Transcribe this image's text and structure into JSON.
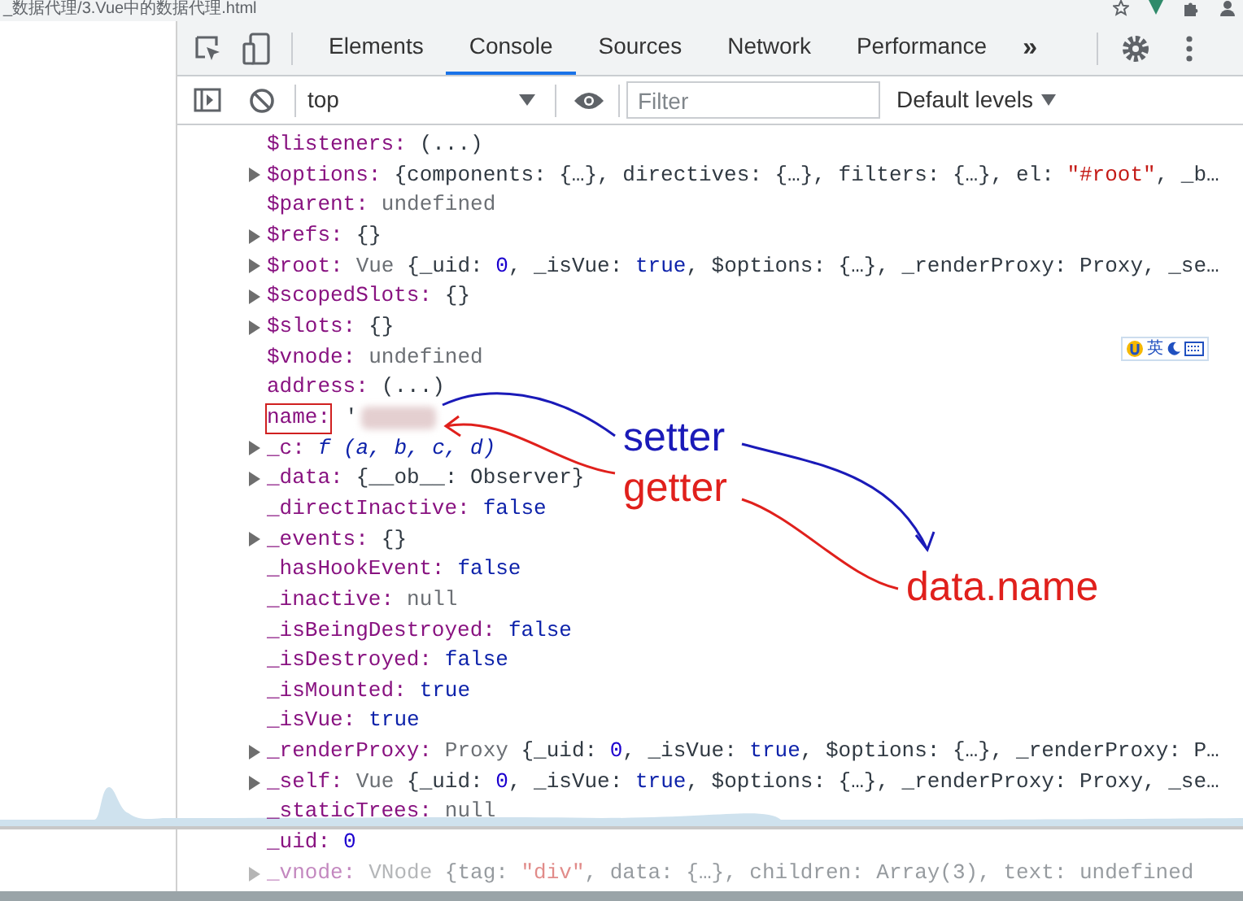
{
  "window": {
    "title": "_数据代理/3.Vue中的数据代理.html"
  },
  "tabs": [
    {
      "label": "Elements",
      "selected": false
    },
    {
      "label": "Console",
      "selected": true
    },
    {
      "label": "Sources",
      "selected": false
    },
    {
      "label": "Network",
      "selected": false
    },
    {
      "label": "Performance",
      "selected": false
    }
  ],
  "more_tabs": "»",
  "toolbar": {
    "context": "top",
    "filter_placeholder": "Filter",
    "levels": "Default levels"
  },
  "ime_bar": {
    "label": "英"
  },
  "lines": [
    {
      "key": "$listeners:",
      "expandable": false,
      "highlighted": false,
      "redacted": false,
      "dimmed": false,
      "parts": [
        {
          "text": "(...)",
          "kind": "plain"
        }
      ]
    },
    {
      "key": "$options:",
      "expandable": true,
      "highlighted": false,
      "redacted": false,
      "dimmed": false,
      "parts": [
        {
          "text": "{components: {…}, directives: {…}, filters: {…}, el: ",
          "kind": "plain"
        },
        {
          "text": "\"#root\"",
          "kind": "str"
        },
        {
          "text": ", _b…",
          "kind": "plain"
        }
      ]
    },
    {
      "key": "$parent:",
      "expandable": false,
      "highlighted": false,
      "redacted": false,
      "dimmed": false,
      "parts": [
        {
          "text": "undefined",
          "kind": "gray"
        }
      ]
    },
    {
      "key": "$refs:",
      "expandable": true,
      "highlighted": false,
      "redacted": false,
      "dimmed": false,
      "parts": [
        {
          "text": "{}",
          "kind": "plain"
        }
      ]
    },
    {
      "key": "$root:",
      "expandable": true,
      "highlighted": false,
      "redacted": false,
      "dimmed": false,
      "parts": [
        {
          "text": "Vue ",
          "kind": "gray"
        },
        {
          "text": "{_uid: ",
          "kind": "plain"
        },
        {
          "text": "0",
          "kind": "num"
        },
        {
          "text": ", _isVue: ",
          "kind": "plain"
        },
        {
          "text": "true",
          "kind": "bool"
        },
        {
          "text": ", $options: {…}, _renderProxy: Proxy, _se…",
          "kind": "plain"
        }
      ]
    },
    {
      "key": "$scopedSlots:",
      "expandable": true,
      "highlighted": false,
      "redacted": false,
      "dimmed": false,
      "parts": [
        {
          "text": "{}",
          "kind": "plain"
        }
      ]
    },
    {
      "key": "$slots:",
      "expandable": true,
      "highlighted": false,
      "redacted": false,
      "dimmed": false,
      "parts": [
        {
          "text": "{}",
          "kind": "plain"
        }
      ]
    },
    {
      "key": "$vnode:",
      "expandable": false,
      "highlighted": false,
      "redacted": false,
      "dimmed": false,
      "parts": [
        {
          "text": "undefined",
          "kind": "gray"
        }
      ]
    },
    {
      "key": "address:",
      "expandable": false,
      "highlighted": false,
      "redacted": false,
      "dimmed": false,
      "parts": [
        {
          "text": "(...)",
          "kind": "plain"
        }
      ]
    },
    {
      "key": "name:",
      "expandable": false,
      "highlighted": true,
      "redacted": true,
      "dimmed": false,
      "parts": [
        {
          "text": "'",
          "kind": "plain"
        }
      ]
    },
    {
      "key": "_c:",
      "expandable": true,
      "highlighted": false,
      "redacted": false,
      "dimmed": false,
      "parts": [
        {
          "text": "f (a, b, c, d)",
          "kind": "fn"
        }
      ]
    },
    {
      "key": "_data:",
      "expandable": true,
      "highlighted": false,
      "redacted": false,
      "dimmed": false,
      "parts": [
        {
          "text": "{__ob__: Observer}",
          "kind": "plain"
        }
      ]
    },
    {
      "key": "_directInactive:",
      "expandable": false,
      "highlighted": false,
      "redacted": false,
      "dimmed": false,
      "parts": [
        {
          "text": "false",
          "kind": "bool"
        }
      ]
    },
    {
      "key": "_events:",
      "expandable": true,
      "highlighted": false,
      "redacted": false,
      "dimmed": false,
      "parts": [
        {
          "text": "{}",
          "kind": "plain"
        }
      ]
    },
    {
      "key": "_hasHookEvent:",
      "expandable": false,
      "highlighted": false,
      "redacted": false,
      "dimmed": false,
      "parts": [
        {
          "text": "false",
          "kind": "bool"
        }
      ]
    },
    {
      "key": "_inactive:",
      "expandable": false,
      "highlighted": false,
      "redacted": false,
      "dimmed": false,
      "parts": [
        {
          "text": "null",
          "kind": "gray"
        }
      ]
    },
    {
      "key": "_isBeingDestroyed:",
      "expandable": false,
      "highlighted": false,
      "redacted": false,
      "dimmed": false,
      "parts": [
        {
          "text": "false",
          "kind": "bool"
        }
      ]
    },
    {
      "key": "_isDestroyed:",
      "expandable": false,
      "highlighted": false,
      "redacted": false,
      "dimmed": false,
      "parts": [
        {
          "text": "false",
          "kind": "bool"
        }
      ]
    },
    {
      "key": "_isMounted:",
      "expandable": false,
      "highlighted": false,
      "redacted": false,
      "dimmed": false,
      "parts": [
        {
          "text": "true",
          "kind": "bool"
        }
      ]
    },
    {
      "key": "_isVue:",
      "expandable": false,
      "highlighted": false,
      "redacted": false,
      "dimmed": false,
      "parts": [
        {
          "text": "true",
          "kind": "bool"
        }
      ]
    },
    {
      "key": "_renderProxy:",
      "expandable": true,
      "highlighted": false,
      "redacted": false,
      "dimmed": false,
      "parts": [
        {
          "text": "Proxy ",
          "kind": "gray"
        },
        {
          "text": "{_uid: ",
          "kind": "plain"
        },
        {
          "text": "0",
          "kind": "num"
        },
        {
          "text": ", _isVue: ",
          "kind": "plain"
        },
        {
          "text": "true",
          "kind": "bool"
        },
        {
          "text": ", $options: {…}, _renderProxy: P…",
          "kind": "plain"
        }
      ]
    },
    {
      "key": "_self:",
      "expandable": true,
      "highlighted": false,
      "redacted": false,
      "dimmed": false,
      "parts": [
        {
          "text": "Vue ",
          "kind": "gray"
        },
        {
          "text": "{_uid: ",
          "kind": "plain"
        },
        {
          "text": "0",
          "kind": "num"
        },
        {
          "text": ", _isVue: ",
          "kind": "plain"
        },
        {
          "text": "true",
          "kind": "bool"
        },
        {
          "text": ", $options: {…}, _renderProxy: Proxy, _se…",
          "kind": "plain"
        }
      ]
    },
    {
      "key": "_staticTrees:",
      "expandable": false,
      "highlighted": false,
      "redacted": false,
      "dimmed": false,
      "parts": [
        {
          "text": "null",
          "kind": "gray"
        }
      ]
    },
    {
      "key": "_uid:",
      "expandable": false,
      "highlighted": false,
      "redacted": false,
      "dimmed": false,
      "parts": [
        {
          "text": "0",
          "kind": "num"
        }
      ]
    },
    {
      "key": "_vnode:",
      "expandable": true,
      "highlighted": false,
      "redacted": false,
      "dimmed": true,
      "parts": [
        {
          "text": "VNode ",
          "kind": "gray"
        },
        {
          "text": "{tag: ",
          "kind": "plain"
        },
        {
          "text": "\"div\"",
          "kind": "str"
        },
        {
          "text": ", data: {…}, children: Array(3), text: undefined",
          "kind": "plain"
        }
      ]
    }
  ],
  "annotations": [
    {
      "text": "setter",
      "color": "#1a1ab8"
    },
    {
      "text": "getter",
      "color": "#e0201c"
    },
    {
      "text": "data.name",
      "color": "#e0201c"
    }
  ]
}
